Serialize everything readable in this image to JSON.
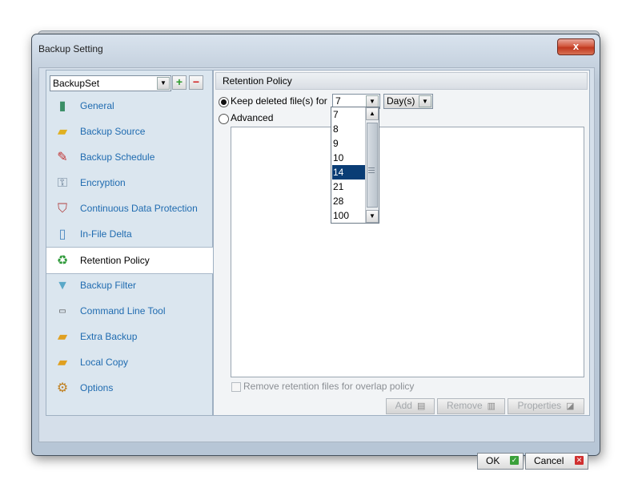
{
  "window": {
    "title": "Backup Setting",
    "close_label": "x"
  },
  "left": {
    "backup_set": "BackupSet",
    "add_label": "+",
    "remove_label": "−",
    "items": [
      {
        "label": "General",
        "icon": "general-icon"
      },
      {
        "label": "Backup Source",
        "icon": "folder-icon"
      },
      {
        "label": "Backup Schedule",
        "icon": "schedule-icon"
      },
      {
        "label": "Encryption",
        "icon": "encryption-icon"
      },
      {
        "label": "Continuous Data Protection",
        "icon": "shield-icon"
      },
      {
        "label": "In-File Delta",
        "icon": "document-icon"
      },
      {
        "label": "Retention Policy",
        "icon": "recycle-bin-icon"
      },
      {
        "label": "Backup Filter",
        "icon": "funnel-icon"
      },
      {
        "label": "Command Line Tool",
        "icon": "terminal-icon"
      },
      {
        "label": "Extra Backup",
        "icon": "extra-backup-icon"
      },
      {
        "label": "Local Copy",
        "icon": "local-copy-icon"
      },
      {
        "label": "Options",
        "icon": "gear-icon"
      }
    ],
    "selected_index": 6
  },
  "right": {
    "header": "Retention Policy",
    "keep_label": "Keep deleted file(s) for",
    "keep_value": "7",
    "unit_value": "Day(s)",
    "advanced_label": "Advanced",
    "dropdown_options": [
      "7",
      "8",
      "9",
      "10",
      "14",
      "21",
      "28",
      "100"
    ],
    "dropdown_selected": "14",
    "remove_overlap_label": "Remove retention files for overlap policy",
    "add_label": "Add",
    "remove_label": "Remove",
    "properties_label": "Properties"
  },
  "footer": {
    "ok_label": "OK",
    "cancel_label": "Cancel"
  },
  "colors": {
    "link": "#1f6bb0",
    "selection": "#0a3d75"
  }
}
